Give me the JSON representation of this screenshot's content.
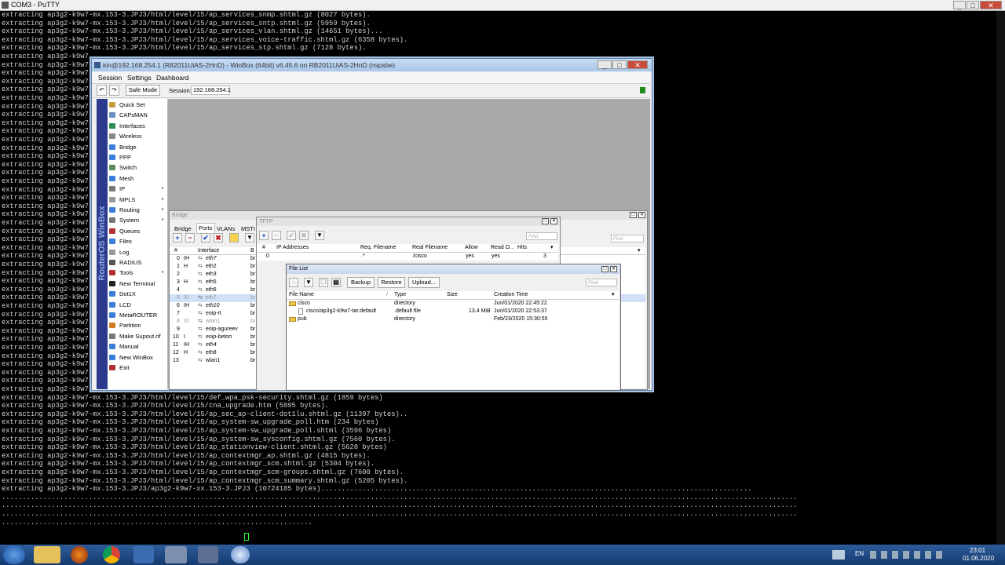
{
  "putty": {
    "title": "COM3 - PuTTY",
    "lines_top": [
      "extracting ap3g2-k9w7-mx.153-3.JPJ3/html/level/15/ap_services_snmp.shtml.gz (8027 bytes).",
      "extracting ap3g2-k9w7-mx.153-3.JPJ3/html/level/15/ap_services_sntp.shtml.gz (5959 bytes).",
      "extracting ap3g2-k9w7-mx.153-3.JPJ3/html/level/15/ap_services_vlan.shtml.gz (14651 bytes)...",
      "extracting ap3g2-k9w7-mx.153-3.JPJ3/html/level/15/ap_services_voice-traffic.shtml.gz (6358 bytes).",
      "extracting ap3g2-k9w7-mx.153-3.JPJ3/html/level/15/ap_services_stp.shtml.gz (7128 bytes)."
    ],
    "left_prefix": "extracting ap3g2-k9w7",
    "lines_bottom": [
      "extracting ap3g2-k9w7-mx.153-3.JPJ3/html/level/15/def_wpa_psk-security.shtml.gz (1859 bytes)",
      "extracting ap3g2-k9w7-mx.153-3.JPJ3/html/level/15/cna_upgrade.htm (5895 bytes).",
      "extracting ap3g2-k9w7-mx.153-3.JPJ3/html/level/15/ap_sec_ap-client-dot1lu.shtml.gz (11397 bytes)..",
      "extracting ap3g2-k9w7-mx.153-3.JPJ3/html/level/15/ap_system-sw_upgrade_poll.htm (234 bytes)",
      "extracting ap3g2-k9w7-mx.153-3.JPJ3/html/level/15/ap_system-sw_upgrade_poll.shtml (3596 bytes)",
      "extracting ap3g2-k9w7-mx.153-3.JPJ3/html/level/15/ap_system-sw_sysconfig.shtml.gz (7560 bytes).",
      "extracting ap3g2-k9w7-mx.153-3.JPJ3/html/level/15/ap_stationview-client.shtml.gz (5628 bytes)",
      "extracting ap3g2-k9w7-mx.153-3.JPJ3/html/level/15/ap_contextmgr_ap.shtml.gz (4815 bytes).",
      "extracting ap3g2-k9w7-mx.153-3.JPJ3/html/level/15/ap_contextmgr_scm.shtml.gz (5304 bytes).",
      "extracting ap3g2-k9w7-mx.153-3.JPJ3/html/level/15/ap_contextmgr_scm-groups.shtml.gz (7600 bytes).",
      "extracting ap3g2-k9w7-mx.153-3.JPJ3/html/level/15/ap_contextmgr_scm_summary.shtml.gz (5205 bytes).",
      "extracting ap3g2-k9w7-mx.153-3.JPJ3/ap3g2-k9w7-xx.153-3.JPJ3 (10724185 bytes)........................................................................................................",
      "................................................................................................................................................................................................",
      "................................................................................................................................................................................................",
      "................................................................................................................................................................................................",
      "..........................................................................."
    ]
  },
  "winbox": {
    "title": "kin@192.168.254.1 (R82011UiAS-2HnD) - WinBox (64bit) v6.45.6 on RB2011UiAS-2HnD (mipsbe)",
    "menu": [
      "Session",
      "Settings",
      "Dashboard"
    ],
    "safe_mode": "Safe Mode",
    "session_label": "Session:",
    "session_value": "192.168.254.1",
    "brand": "RouterOS WinBox",
    "sidebar": [
      {
        "label": "Quick Set",
        "icon": "quick-set-icon",
        "color": "#c89b3c",
        "arrow": false
      },
      {
        "label": "CAPsMAN",
        "icon": "capsman-icon",
        "color": "#6a8fc0",
        "arrow": false
      },
      {
        "label": "Interfaces",
        "icon": "interfaces-icon",
        "color": "#2e8b57",
        "arrow": false
      },
      {
        "label": "Wireless",
        "icon": "wireless-icon",
        "color": "#888888",
        "arrow": false
      },
      {
        "label": "Bridge",
        "icon": "bridge-icon",
        "color": "#3b7dd8",
        "arrow": false
      },
      {
        "label": "PPP",
        "icon": "ppp-icon",
        "color": "#3b7dd8",
        "arrow": false
      },
      {
        "label": "Switch",
        "icon": "switch-icon",
        "color": "#5a8a5a",
        "arrow": false
      },
      {
        "label": "Mesh",
        "icon": "mesh-icon",
        "color": "#3b7dd8",
        "arrow": false
      },
      {
        "label": "IP",
        "icon": "ip-icon",
        "color": "#777777",
        "arrow": true
      },
      {
        "label": "MPLS",
        "icon": "mpls-icon",
        "color": "#999999",
        "arrow": true
      },
      {
        "label": "Routing",
        "icon": "routing-icon",
        "color": "#3b7dd8",
        "arrow": true
      },
      {
        "label": "System",
        "icon": "system-icon",
        "color": "#777777",
        "arrow": true
      },
      {
        "label": "Queues",
        "icon": "queues-icon",
        "color": "#b03030",
        "arrow": false
      },
      {
        "label": "Files",
        "icon": "files-icon",
        "color": "#3b7dd8",
        "arrow": false
      },
      {
        "label": "Log",
        "icon": "log-icon",
        "color": "#999999",
        "arrow": false
      },
      {
        "label": "RADIUS",
        "icon": "radius-icon",
        "color": "#555555",
        "arrow": false
      },
      {
        "label": "Tools",
        "icon": "tools-icon",
        "color": "#b03030",
        "arrow": true
      },
      {
        "label": "New Terminal",
        "icon": "terminal-icon",
        "color": "#222222",
        "arrow": false
      },
      {
        "label": "Dot1X",
        "icon": "dot1x-icon",
        "color": "#3b7dd8",
        "arrow": false
      },
      {
        "label": "LCD",
        "icon": "lcd-icon",
        "color": "#3b7dd8",
        "arrow": false
      },
      {
        "label": "MetaROUTER",
        "icon": "metarouter-icon",
        "color": "#3b7dd8",
        "arrow": false
      },
      {
        "label": "Partition",
        "icon": "partition-icon",
        "color": "#d08020",
        "arrow": false
      },
      {
        "label": "Make Supout.rif",
        "icon": "supout-icon",
        "color": "#777777",
        "arrow": false
      },
      {
        "label": "Manual",
        "icon": "manual-icon",
        "color": "#3b7dd8",
        "arrow": false
      },
      {
        "label": "New WinBox",
        "icon": "winbox-icon",
        "color": "#3b7dd8",
        "arrow": false
      },
      {
        "label": "Exit",
        "icon": "exit-icon",
        "color": "#b03030",
        "arrow": false
      }
    ]
  },
  "bridge": {
    "title": "Bridge",
    "tabs": [
      "Bridge",
      "Ports",
      "VLANs",
      "MSTI"
    ],
    "find": "Find",
    "headers": [
      "#",
      "Interface",
      "B"
    ],
    "rows": [
      {
        "n": "0",
        "f": "IH",
        "iface": "eth7",
        "b": "br"
      },
      {
        "n": "1",
        "f": "H",
        "iface": "eth2",
        "b": "br"
      },
      {
        "n": "2",
        "f": "",
        "iface": "eth3",
        "b": "br"
      },
      {
        "n": "3",
        "f": "H",
        "iface": "eth5",
        "b": "br"
      },
      {
        "n": "4",
        "f": "",
        "iface": "eth6",
        "b": "br"
      },
      {
        "n": "5",
        "f": "XI",
        "iface": "eth7",
        "b": "br"
      },
      {
        "n": "6",
        "f": "IH",
        "iface": "eth10",
        "b": "br"
      },
      {
        "n": "7",
        "f": "",
        "iface": "eoip-rt",
        "b": "br"
      },
      {
        "n": "8",
        "f": "XI",
        "iface": "wlan1",
        "b": "br"
      },
      {
        "n": "9",
        "f": "",
        "iface": "eoip-agureev",
        "b": "br"
      },
      {
        "n": "10",
        "f": "I",
        "iface": "eoip-beton",
        "b": "br"
      },
      {
        "n": "11",
        "f": "IH",
        "iface": "eth4",
        "b": "br"
      },
      {
        "n": "12",
        "f": "H",
        "iface": "eth8",
        "b": "br"
      },
      {
        "n": "13",
        "f": "",
        "iface": "wlan1",
        "b": "br"
      }
    ]
  },
  "tftp": {
    "title": "TFTP",
    "find": "Find",
    "headers": [
      "#",
      "IP Addresses",
      "Req. Filename",
      "Real Filename",
      "Allow",
      "Read O...",
      "Hits"
    ],
    "row": {
      "n": "0",
      "ip": "",
      "req": ".*",
      "real": "/cisco",
      "allow": "yes",
      "ro": "yes",
      "hits": "3"
    }
  },
  "filelist": {
    "title": "File List",
    "buttons": [
      "Backup",
      "Restore",
      "Upload..."
    ],
    "find": "Find",
    "headers": [
      "File Name",
      "Type",
      "Size",
      "Creation Time"
    ],
    "rows": [
      {
        "name": "cisco",
        "type": "directory",
        "size": "",
        "time": "Jun/01/2020 22:45:22"
      },
      {
        "name": "cisco/ap3g2-k9w7-tar.default",
        "type": ".default file",
        "size": "13.4 MiB",
        "time": "Jun/01/2020 22:53:37"
      },
      {
        "name": "pub",
        "type": "directory",
        "size": "",
        "time": "Feb/23/2020 15:30:55"
      }
    ]
  },
  "tray": {
    "lang": "EN",
    "time": "23:01",
    "date": "01.06.2020"
  }
}
